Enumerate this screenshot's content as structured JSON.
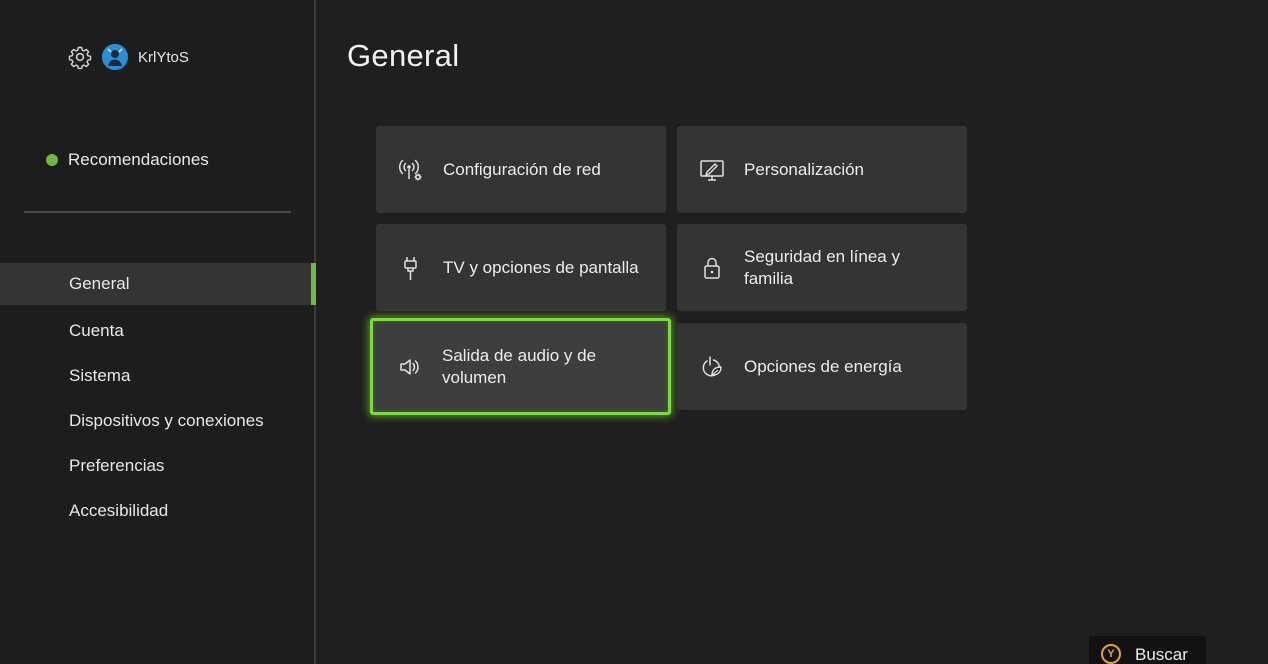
{
  "profile": {
    "gear_icon": "gear-icon",
    "gamertag": "KrlYtoS"
  },
  "recommendations": {
    "label": "Recomendaciones",
    "status_color": "#6cbb3c"
  },
  "nav": {
    "items": [
      {
        "label": "General",
        "active": true
      },
      {
        "label": "Cuenta"
      },
      {
        "label": "Sistema"
      },
      {
        "label": "Dispositivos y conexiones"
      },
      {
        "label": "Preferencias"
      },
      {
        "label": "Accesibilidad"
      }
    ]
  },
  "main": {
    "title": "General",
    "tiles": [
      {
        "label": "Configuración de red",
        "icon": "network-settings-icon"
      },
      {
        "label": "Personalización",
        "icon": "personalization-icon"
      },
      {
        "label": "TV y opciones de pantalla",
        "icon": "hdmi-cable-icon"
      },
      {
        "label": "Seguridad en línea y familia",
        "icon": "lock-icon"
      },
      {
        "label": "Salida de audio y de volumen",
        "icon": "speaker-icon",
        "focused": true
      },
      {
        "label": "Opciones de energía",
        "icon": "power-leaf-icon"
      }
    ]
  },
  "hint": {
    "button": "Y",
    "label": "Buscar"
  },
  "colors": {
    "accent": "#6cbb3c",
    "focus": "#7ddc3a",
    "y_button": "#e3a33a"
  }
}
